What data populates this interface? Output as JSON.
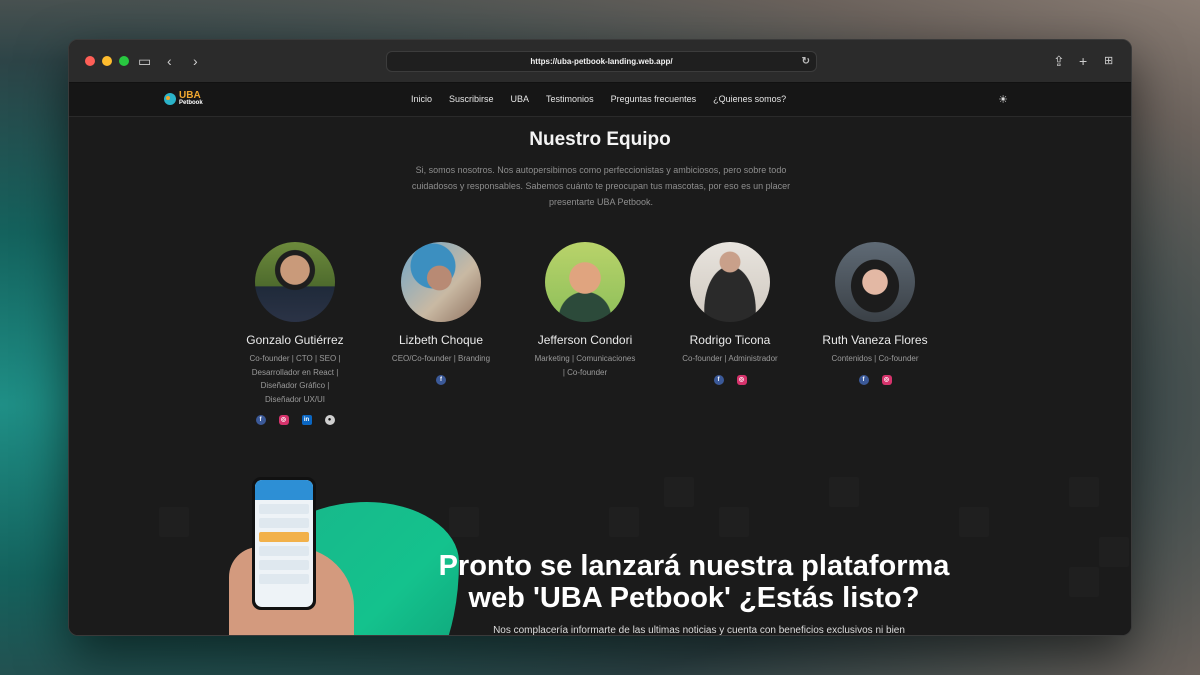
{
  "browser": {
    "url": "https://uba-petbook-landing.web.app/"
  },
  "site": {
    "logo_uba": "UBA",
    "logo_petbook": "Petbook",
    "nav": [
      "Inicio",
      "Suscribirse",
      "UBA",
      "Testimonios",
      "Preguntas frecuentes",
      "¿Quienes somos?"
    ]
  },
  "team": {
    "title": "Nuestro Equipo",
    "description": "Si, somos nosotros. Nos autopersibimos como perfeccionistas y ambiciosos, pero sobre todo cuidadosos y responsables. Sabemos cuánto te preocupan tus mascotas, por eso es un placer presentarte UBA Petbook.",
    "members": [
      {
        "name": "Gonzalo Gutiérrez",
        "role": "Co-founder | CTO | SEO | Desarrollador en React | Diseñador Gráfico | Diseñador UX/UI",
        "socials": [
          "facebook-icon",
          "instagram-icon",
          "linkedin-icon",
          "github-icon"
        ]
      },
      {
        "name": "Lizbeth Choque",
        "role": "CEO/Co-founder | Branding",
        "socials": [
          "facebook-icon"
        ]
      },
      {
        "name": "Jefferson Condori",
        "role": "Marketing | Comunicaciones | Co-founder",
        "socials": []
      },
      {
        "name": "Rodrigo Ticona",
        "role": "Co-founder | Administrador",
        "socials": [
          "facebook-icon",
          "instagram-icon"
        ]
      },
      {
        "name": "Ruth Vaneza Flores",
        "role": "Contenidos | Co-founder",
        "socials": [
          "facebook-icon",
          "instagram-icon"
        ]
      }
    ]
  },
  "cta": {
    "title": "Pronto se lanzará nuestra plataforma web 'UBA Petbook' ¿Estás listo?",
    "subtitle": "Nos complacería informarte de las ultimas noticias y cuenta con beneficios exclusivos ni bien"
  },
  "colors": {
    "accent_orange": "#f0a830",
    "accent_green": "#14c28d",
    "facebook": "#3b5998",
    "instagram": "#d6336c",
    "linkedin": "#0a66c2"
  }
}
